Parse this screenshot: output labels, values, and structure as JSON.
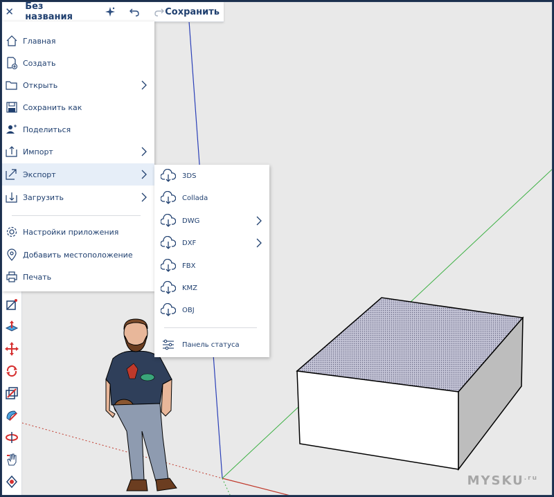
{
  "topbar": {
    "title": "Без названия",
    "save_label": "Сохранить"
  },
  "menu": {
    "items": [
      {
        "label": "Главная",
        "icon": "home-icon"
      },
      {
        "label": "Создать",
        "icon": "new-file-icon"
      },
      {
        "label": "Открыть",
        "icon": "folder-icon",
        "has_submenu": true
      },
      {
        "label": "Сохранить как",
        "icon": "save-icon"
      },
      {
        "label": "Поделиться",
        "icon": "share-user-icon"
      },
      {
        "label": "Импорт",
        "icon": "import-icon",
        "has_submenu": true
      },
      {
        "label": "Экспорт",
        "icon": "export-icon",
        "has_submenu": true,
        "active": true
      },
      {
        "label": "Загрузить",
        "icon": "download-icon",
        "has_submenu": true
      },
      {
        "label": "Настройки приложения",
        "icon": "gear-icon"
      },
      {
        "label": "Добавить местоположение",
        "icon": "location-pin-icon"
      },
      {
        "label": "Печать",
        "icon": "printer-icon"
      }
    ]
  },
  "export_submenu": {
    "items": [
      {
        "label": "3DS",
        "icon": "cloud-download-icon"
      },
      {
        "label": "Collada",
        "icon": "cloud-download-icon"
      },
      {
        "label": "DWG",
        "icon": "cloud-download-icon",
        "has_submenu": true
      },
      {
        "label": "DXF",
        "icon": "cloud-download-icon",
        "has_submenu": true
      },
      {
        "label": "FBX",
        "icon": "cloud-download-icon"
      },
      {
        "label": "KMZ",
        "icon": "cloud-download-icon"
      },
      {
        "label": "OBJ",
        "icon": "cloud-download-icon"
      }
    ],
    "status_panel_label": "Панель статуса"
  },
  "watermark": {
    "text": "MYSKU",
    "suffix": ".ru"
  },
  "colors": {
    "accent": "#1f3f6f",
    "active_bg": "#e6eef8",
    "axis_blue": "#2a3fb8",
    "axis_green": "#3cb043",
    "axis_red": "#c0392b"
  }
}
